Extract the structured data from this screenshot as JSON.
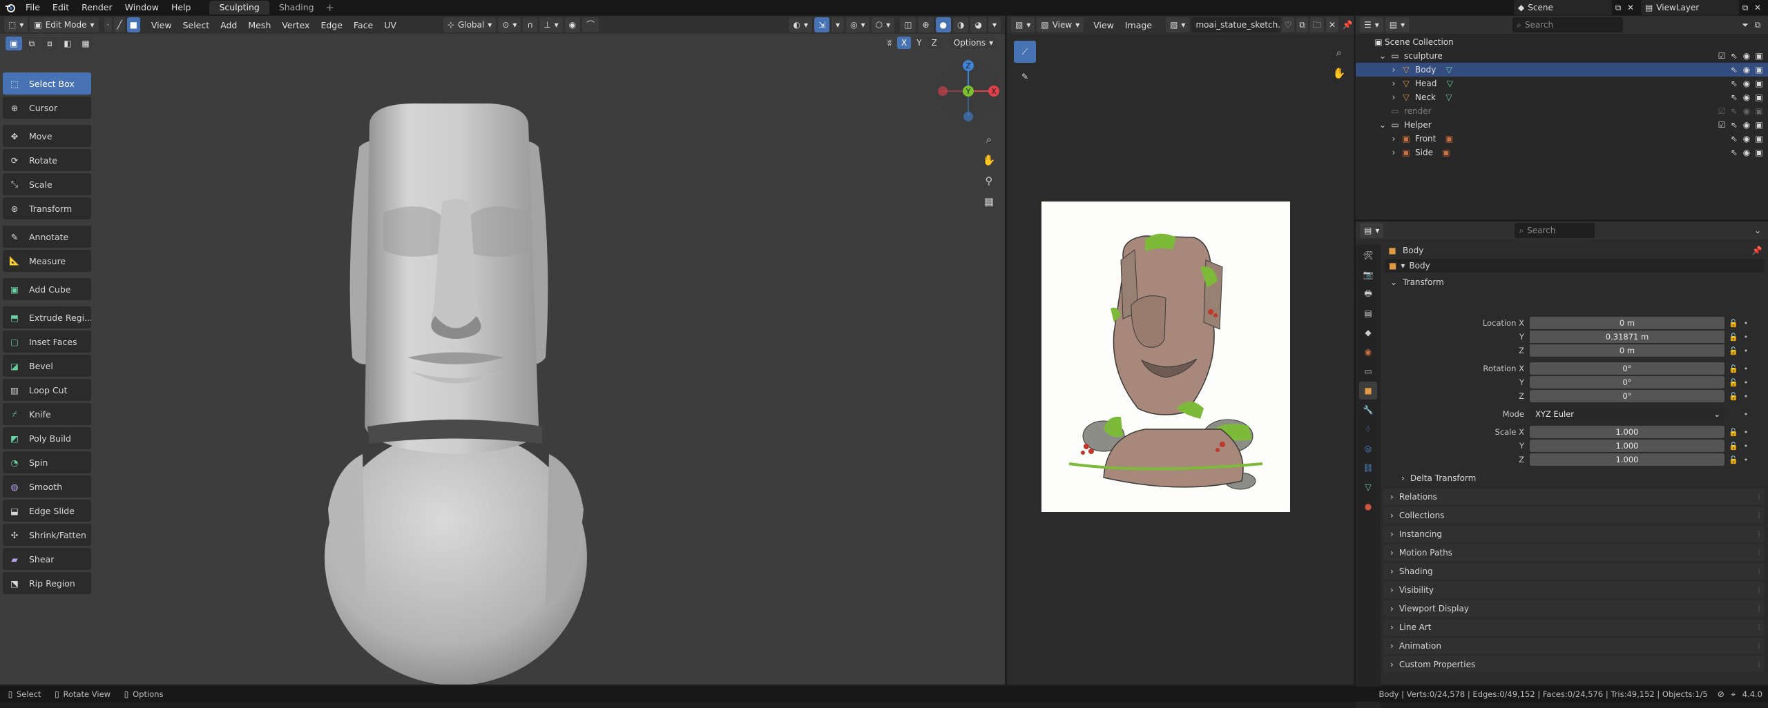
{
  "topbar": {
    "menus": [
      "File",
      "Edit",
      "Render",
      "Window",
      "Help"
    ],
    "workspace_tabs": [
      {
        "label": "Sculpting"
      },
      {
        "label": "Shading"
      }
    ],
    "scene": "Scene",
    "view_layer": "ViewLayer"
  },
  "viewport_header": {
    "mode": "Edit Mode",
    "menus": [
      "View",
      "Select",
      "Add",
      "Mesh",
      "Vertex",
      "Edge",
      "Face",
      "UV"
    ],
    "orientation": "Global",
    "options": "Options",
    "axes": [
      "X",
      "Y",
      "Z"
    ]
  },
  "tools": [
    "Select Box",
    "Cursor",
    "Move",
    "Rotate",
    "Scale",
    "Transform",
    "Annotate",
    "Measure",
    "Add Cube",
    "Extrude Regi...",
    "Inset Faces",
    "Bevel",
    "Loop Cut",
    "Knife",
    "Poly Build",
    "Spin",
    "Smooth",
    "Edge Slide",
    "Shrink/Fatten",
    "Shear",
    "Rip Region"
  ],
  "gizmo": {
    "x": "X",
    "y": "Y",
    "z": "Z",
    "x_color": "#e0424b",
    "y_color": "#7cc02e",
    "z_color": "#3d83d6"
  },
  "image_editor": {
    "view_menu": "View",
    "menus": [
      "View",
      "Image"
    ],
    "image_name": "moai_statue_sketch.jpg"
  },
  "outliner": {
    "search_placeholder": "Search",
    "scene_collection": "Scene Collection",
    "items": [
      {
        "name": "sculpture",
        "depth": 1,
        "type": "collection"
      },
      {
        "name": "Body",
        "depth": 2,
        "type": "mesh",
        "selected": true
      },
      {
        "name": "Head",
        "depth": 2,
        "type": "mesh"
      },
      {
        "name": "Neck",
        "depth": 2,
        "type": "mesh"
      },
      {
        "name": "render",
        "depth": 1,
        "type": "collection",
        "dim": true
      },
      {
        "name": "Helper",
        "depth": 1,
        "type": "collection"
      },
      {
        "name": "Front",
        "depth": 2,
        "type": "image"
      },
      {
        "name": "Side",
        "depth": 2,
        "type": "image"
      }
    ]
  },
  "properties": {
    "search_placeholder": "Search",
    "object_name": "Body",
    "object_field": "Body",
    "transform_label": "Transform",
    "location": {
      "label": "Location X",
      "x": "0 m",
      "y": "0.31871 m",
      "z": "0 m"
    },
    "rotation": {
      "label": "Rotation X",
      "x": "0°",
      "y": "0°",
      "z": "0°"
    },
    "mode": {
      "label": "Mode",
      "value": "XYZ Euler"
    },
    "scale": {
      "label": "Scale X",
      "x": "1.000",
      "y": "1.000",
      "z": "1.000"
    },
    "axis_y": "Y",
    "axis_z": "Z",
    "delta": "Delta Transform",
    "sections": [
      "Relations",
      "Collections",
      "Instancing",
      "Motion Paths",
      "Shading",
      "Visibility",
      "Viewport Display",
      "Line Art",
      "Animation",
      "Custom Properties"
    ]
  },
  "statusbar": {
    "select": "Select",
    "rotate": "Rotate View",
    "options": "Options",
    "stats": "Body | Verts:0/24,578 | Edges:0/49,152 | Faces:0/24,576 | Tris:49,152 | Objects:1/5",
    "version": "4.4.0"
  },
  "colors": {
    "accent": "#4772b3",
    "mesh_icon": "#e09a45",
    "mesh_data": "#6ad3a4",
    "image_icon": "#d06e3c"
  }
}
